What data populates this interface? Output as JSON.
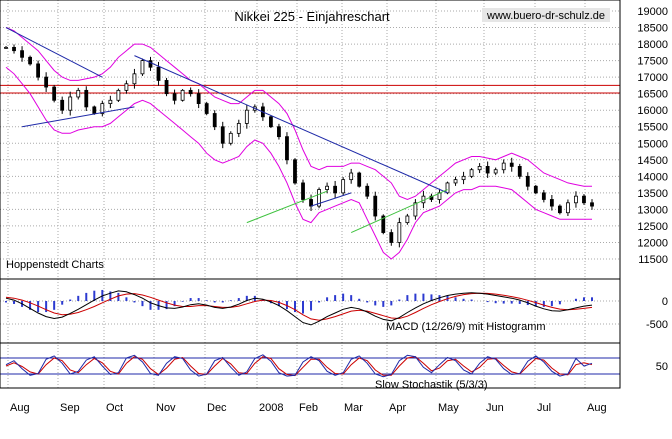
{
  "chart_data": [
    {
      "type": "line",
      "subtype": "candlestick with Bollinger bands",
      "title": "Nikkei 225 - Einjahreschart",
      "watermark": "www.buero-dr-schulz.de",
      "source_label": "Hoppenstedt Charts",
      "x_tick_labels": [
        "Aug",
        "Sep",
        "Oct",
        "Nov",
        "Dec",
        "2008",
        "Feb",
        "Mar",
        "Apr",
        "May",
        "Jun",
        "Jul",
        "Aug"
      ],
      "y_tick_labels": [
        "11500",
        "12000",
        "12500",
        "13000",
        "13500",
        "14000",
        "14500",
        "15000",
        "15500",
        "16000",
        "16500",
        "17000",
        "17500",
        "18000",
        "18500",
        "19000"
      ],
      "ylim": [
        11200,
        19150
      ],
      "grid": true,
      "price_close": [
        17900,
        17800,
        17600,
        17400,
        17000,
        16700,
        16300,
        16000,
        16400,
        16600,
        16100,
        15900,
        16200,
        16300,
        16600,
        16800,
        17100,
        17500,
        17300,
        16900,
        16500,
        16300,
        16600,
        16500,
        16200,
        15900,
        15500,
        15000,
        15300,
        15600,
        16000,
        16100,
        15800,
        15500,
        15200,
        14500,
        13800,
        13300,
        13100,
        13600,
        13700,
        13500,
        13900,
        14100,
        13700,
        13400,
        12800,
        12300,
        12000,
        12600,
        12800,
        13200,
        13400,
        13300,
        13500,
        13800,
        13900,
        14000,
        14200,
        14300,
        14100,
        14200,
        14400,
        14300,
        14000,
        13700,
        13500,
        13300,
        13100,
        12900,
        13200,
        13400,
        13200,
        13100
      ],
      "bollinger_upper": [
        18500,
        18400,
        18200,
        18000,
        17800,
        17500,
        17200,
        17000,
        16900,
        16900,
        16950,
        17000,
        17100,
        17300,
        17600,
        17800,
        18000,
        18000,
        17900,
        17700,
        17500,
        17300,
        17100,
        16900,
        16800,
        16600,
        16400,
        16300,
        16200,
        16200,
        16400,
        16600,
        16600,
        16400,
        16200,
        15900,
        15400,
        14800,
        14300,
        14200,
        14300,
        14300,
        14300,
        14400,
        14400,
        14300,
        14200,
        14000,
        13800,
        13400,
        13300,
        13400,
        13600,
        13800,
        14000,
        14200,
        14400,
        14500,
        14600,
        14600,
        14550,
        14500,
        14600,
        14700,
        14600,
        14500,
        14300,
        14100,
        14000,
        13900,
        13800,
        13750,
        13700,
        13700
      ],
      "bollinger_lower": [
        17300,
        17100,
        16800,
        16500,
        16100,
        15700,
        15400,
        15300,
        15300,
        15400,
        15450,
        15500,
        15500,
        15600,
        15800,
        16000,
        16200,
        16300,
        16200,
        16000,
        15800,
        15600,
        15400,
        15200,
        15000,
        14700,
        14500,
        14400,
        14500,
        14600,
        14900,
        15100,
        15000,
        14700,
        14300,
        13800,
        13200,
        12700,
        12600,
        12900,
        13000,
        13100,
        13200,
        13300,
        13200,
        12700,
        12200,
        11700,
        11500,
        11700,
        12100,
        12600,
        12900,
        13000,
        13100,
        13300,
        13500,
        13600,
        13600,
        13700,
        13700,
        13700,
        13650,
        13600,
        13400,
        13200,
        13000,
        12900,
        12800,
        12700,
        12700,
        12700,
        12700,
        12700
      ],
      "horizontal_lines": [
        {
          "value": 16750,
          "color": "#cc0000"
        },
        {
          "value": 16520,
          "color": "#cc0000"
        }
      ],
      "trendlines": [
        {
          "color": "#1f2aa8",
          "points": [
            [
              0,
              18500
            ],
            [
              12,
              17000
            ]
          ]
        },
        {
          "color": "#1f2aa8",
          "points": [
            [
              2,
              15500
            ],
            [
              16,
              16100
            ]
          ]
        },
        {
          "color": "#1f2aa8",
          "points": [
            [
              16,
              17650
            ],
            [
              55,
              13500
            ]
          ]
        },
        {
          "color": "#1f2aa8",
          "points": [
            [
              38,
              13100
            ],
            [
              43,
              13500
            ]
          ]
        },
        {
          "color": "#3ec23e",
          "points": [
            [
              30,
              12600
            ],
            [
              40,
              13550
            ]
          ]
        },
        {
          "color": "#3ec23e",
          "points": [
            [
              43,
              12300
            ],
            [
              55,
              13600
            ]
          ]
        }
      ],
      "colors": {
        "candles": "#000000",
        "bands": "#e000e0",
        "grid": "#aaaaaa"
      }
    },
    {
      "type": "line",
      "label": "MACD (12/26/9) mit Histogramm",
      "y_tick_labels": [
        "0",
        "-500"
      ],
      "ylim": [
        -700,
        250
      ],
      "macd": [
        60,
        20,
        -60,
        -160,
        -260,
        -340,
        -380,
        -350,
        -270,
        -180,
        -80,
        20,
        110,
        170,
        220,
        200,
        140,
        60,
        -40,
        -100,
        -150,
        -160,
        -130,
        -80,
        -60,
        -90,
        -140,
        -160,
        -130,
        -70,
        10,
        60,
        40,
        -20,
        -100,
        -210,
        -340,
        -470,
        -520,
        -440,
        -340,
        -260,
        -180,
        -140,
        -170,
        -240,
        -330,
        -400,
        -430,
        -360,
        -250,
        -150,
        -60,
        10,
        70,
        120,
        150,
        170,
        180,
        170,
        150,
        120,
        90,
        60,
        20,
        -40,
        -110,
        -170,
        -210,
        -220,
        -190,
        -150,
        -110,
        -90
      ],
      "signal": [
        80,
        60,
        20,
        -40,
        -110,
        -190,
        -260,
        -300,
        -290,
        -250,
        -190,
        -120,
        -40,
        40,
        110,
        150,
        160,
        130,
        80,
        20,
        -40,
        -90,
        -120,
        -120,
        -100,
        -100,
        -120,
        -140,
        -140,
        -110,
        -60,
        -10,
        20,
        10,
        -30,
        -100,
        -190,
        -300,
        -390,
        -420,
        -390,
        -340,
        -280,
        -220,
        -200,
        -220,
        -270,
        -320,
        -370,
        -380,
        -330,
        -250,
        -160,
        -80,
        -10,
        50,
        100,
        140,
        160,
        170,
        165,
        150,
        125,
        95,
        60,
        15,
        -35,
        -90,
        -140,
        -175,
        -190,
        -180,
        -160,
        -140
      ],
      "colors": {
        "macd": "#000000",
        "signal": "#cc0000",
        "histogram": "#2c3ad0"
      }
    },
    {
      "type": "line",
      "label": "Slow Stochastik (5/3/3)",
      "y_tick_labels": [
        "50"
      ],
      "ylim": [
        0,
        100
      ],
      "reference_lines": [
        80,
        20
      ],
      "k": [
        55,
        70,
        40,
        15,
        22,
        75,
        88,
        60,
        20,
        30,
        72,
        85,
        50,
        18,
        25,
        80,
        90,
        65,
        22,
        15,
        60,
        85,
        78,
        35,
        12,
        20,
        70,
        82,
        45,
        15,
        28,
        78,
        92,
        68,
        25,
        12,
        15,
        65,
        85,
        70,
        30,
        15,
        25,
        75,
        88,
        60,
        20,
        10,
        18,
        70,
        90,
        85,
        45,
        25,
        55,
        82,
        70,
        35,
        20,
        60,
        85,
        75,
        40,
        18,
        22,
        68,
        88,
        65,
        30,
        12,
        20,
        78,
        50,
        60
      ],
      "d": [
        50,
        62,
        48,
        28,
        20,
        55,
        80,
        70,
        35,
        25,
        55,
        78,
        62,
        30,
        20,
        60,
        85,
        75,
        40,
        18,
        42,
        75,
        82,
        50,
        22,
        18,
        50,
        78,
        58,
        25,
        22,
        60,
        85,
        78,
        40,
        18,
        14,
        45,
        75,
        75,
        45,
        22,
        20,
        55,
        80,
        70,
        35,
        15,
        15,
        50,
        80,
        85,
        60,
        32,
        42,
        70,
        75,
        50,
        28,
        45,
        75,
        78,
        52,
        28,
        20,
        50,
        78,
        72,
        42,
        20,
        17,
        55,
        62,
        55
      ],
      "colors": {
        "k": "#1f2aa8",
        "d": "#cc0000",
        "reference": "#1f2aa8"
      }
    }
  ]
}
